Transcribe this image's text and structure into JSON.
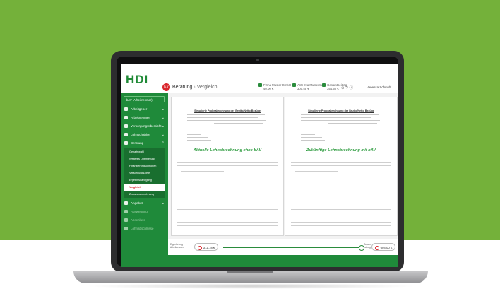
{
  "header": {
    "logo": "HDI",
    "badge": "KV",
    "breadcrumb": {
      "parent": "Beratung",
      "separator": "›",
      "current": "Vergleich"
    },
    "info": [
      {
        "label": "Firma Muster GmbH",
        "value": "40,00 €"
      },
      {
        "label": "Arzt Eva Mustermann",
        "value": "300,55 €"
      },
      {
        "label": "Gesamtbeitrag",
        "value": "354,50 €"
      }
    ],
    "user": "Vanessa Schmidt"
  },
  "sidebar": {
    "top_select": "bAV (Arbeitnehmer)",
    "items": [
      {
        "label": "Arbeitgeber"
      },
      {
        "label": "Arbeitnehmer"
      },
      {
        "label": "Versorgungsübersicht"
      },
      {
        "label": "Lohnschablon"
      },
      {
        "label": "Beratung"
      }
    ],
    "subitems": [
      {
        "label": "Gehaltswahl"
      },
      {
        "label": "Weiteres Optimierung"
      },
      {
        "label": "Finanzierungsoptionen"
      },
      {
        "label": "Versorgungsziele"
      },
      {
        "label": "Ergebnisdarlegung"
      },
      {
        "label": "Vergleich"
      },
      {
        "label": "Zusammenrechnung"
      }
    ],
    "bottom_items": [
      {
        "label": "Angebot"
      },
      {
        "label": "Auswertung"
      },
      {
        "label": "Abschluss"
      },
      {
        "label": "Lohnabschlüsse"
      }
    ]
  },
  "comparison": {
    "left_title": "Aktuelle Lohnabrechnung ohne bAV",
    "right_title": "Zukünftige Lohnabrechnung mit bAV",
    "doc_heading": "Simulierte Probeabrechnung der Brutto/Netto Bezüge"
  },
  "bottom_bar": {
    "left_label": "Eigenbeitrag",
    "left_sub": "Arbeitnehmer",
    "left_value": "372,78 €",
    "right_label": "Gesamt",
    "right_sub": "beitrag",
    "right_value": "604,00 €"
  },
  "colors": {
    "green": "#1f8a3a",
    "band": "#74b13a",
    "accent_red": "#d9262c"
  }
}
